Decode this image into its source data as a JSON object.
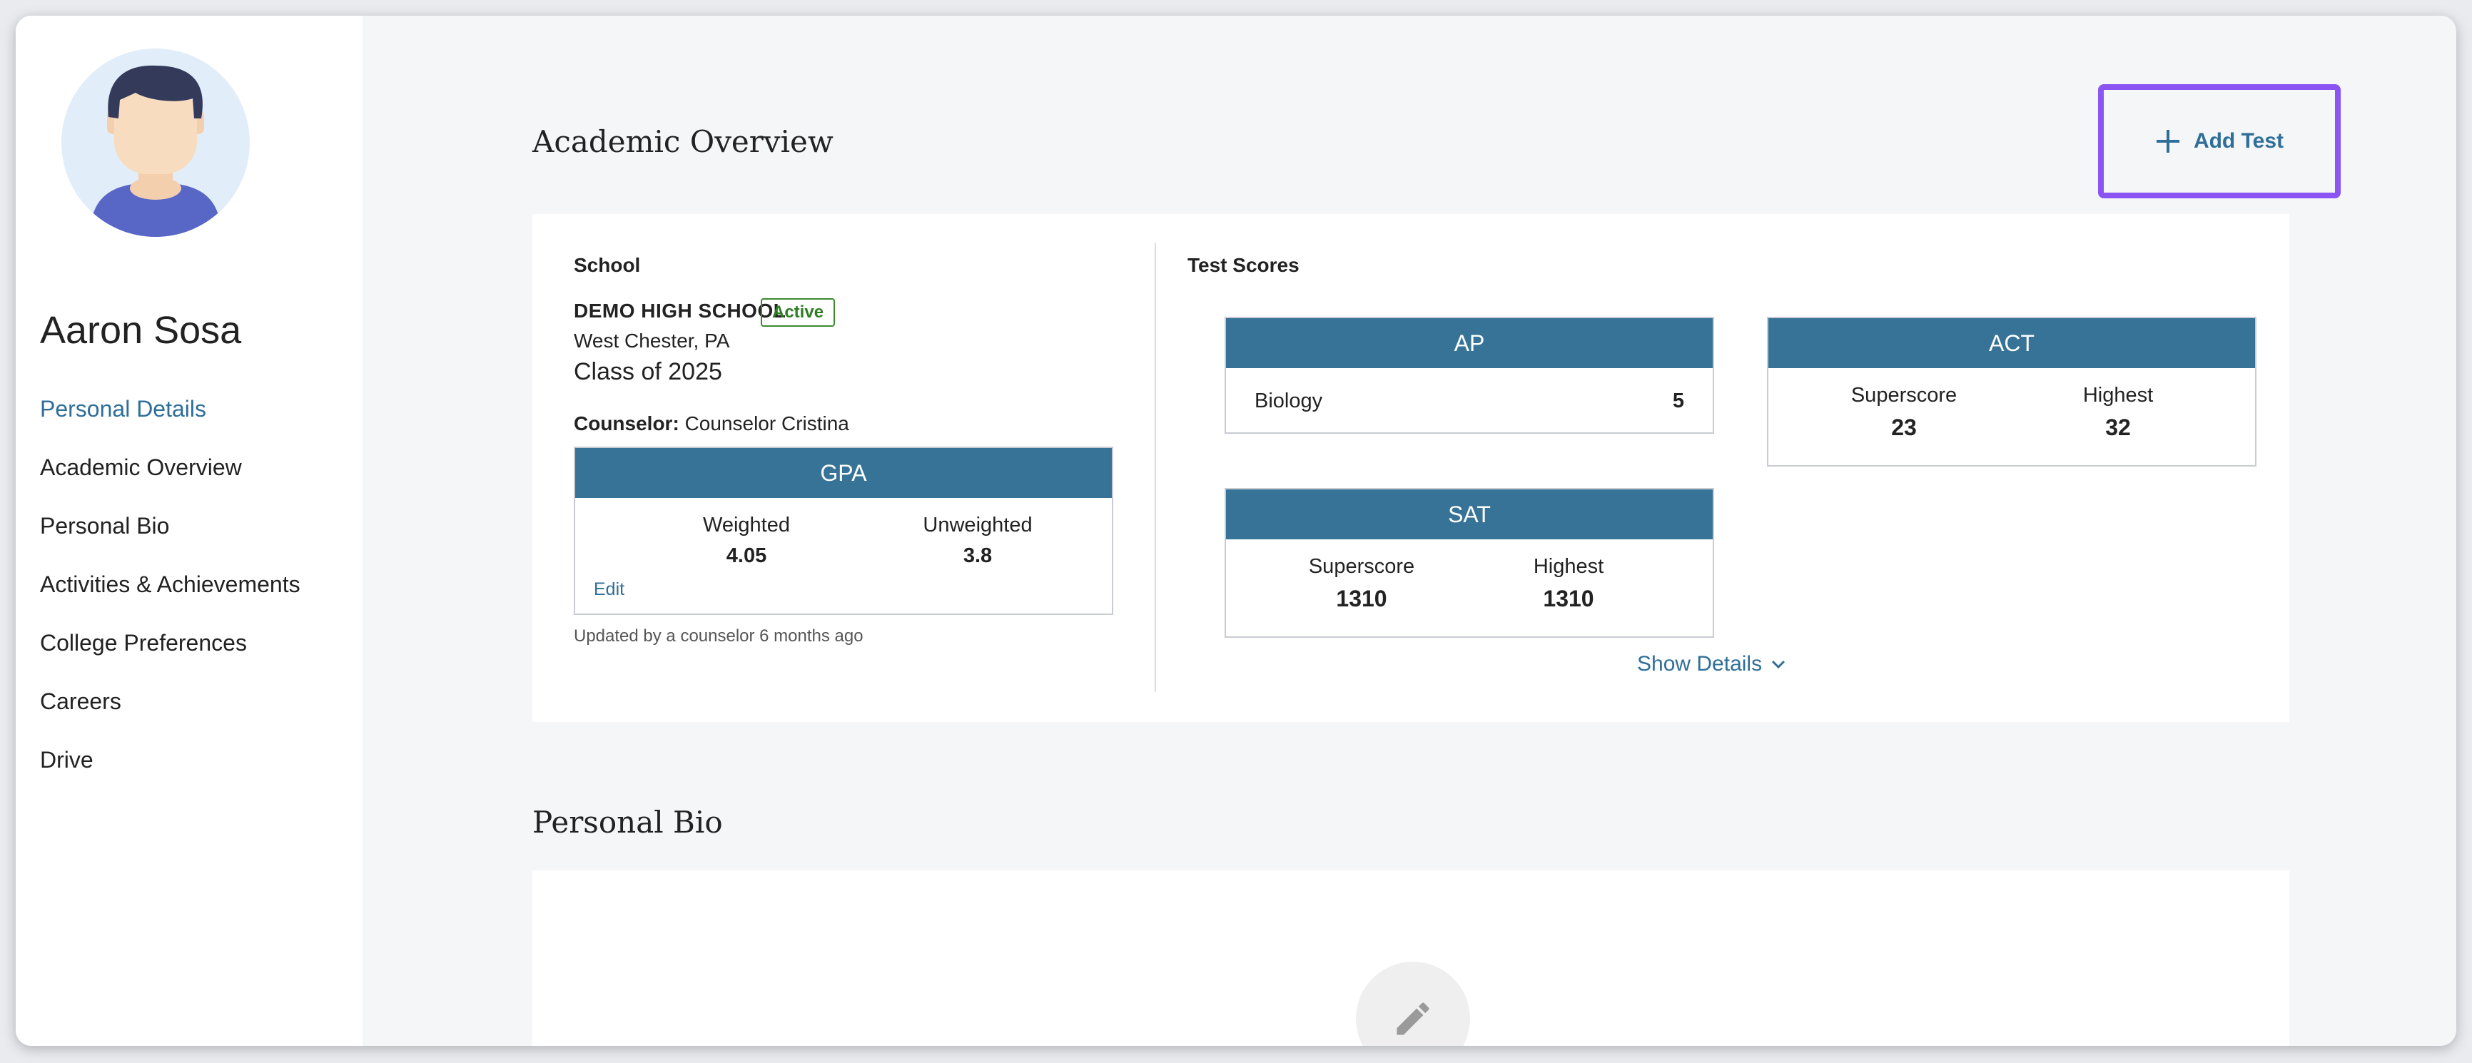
{
  "student": {
    "name": "Aaron Sosa"
  },
  "nav": {
    "items": [
      {
        "label": "Personal Details",
        "active": true
      },
      {
        "label": "Academic Overview"
      },
      {
        "label": "Personal Bio"
      },
      {
        "label": "Activities & Achievements"
      },
      {
        "label": "College Preferences"
      },
      {
        "label": "Careers"
      },
      {
        "label": "Drive"
      }
    ]
  },
  "academic": {
    "title": "Academic Overview",
    "add_test_label": "Add Test",
    "school": {
      "heading": "School",
      "name": "DEMO HIGH SCHOOL",
      "status": "Active",
      "location": "West Chester, PA",
      "class_of": "Class of 2025",
      "counselor_label": "Counselor:",
      "counselor_name": "Counselor Cristina"
    },
    "gpa": {
      "title": "GPA",
      "weighted_label": "Weighted",
      "weighted": "4.05",
      "unweighted_label": "Unweighted",
      "unweighted": "3.8",
      "edit_label": "Edit",
      "updated": "Updated by a counselor 6 months ago"
    },
    "test_scores": {
      "heading": "Test Scores",
      "ap": {
        "title": "AP",
        "subject": "Biology",
        "score": "5"
      },
      "act": {
        "title": "ACT",
        "superscore_label": "Superscore",
        "superscore": "23",
        "highest_label": "Highest",
        "highest": "32"
      },
      "sat": {
        "title": "SAT",
        "superscore_label": "Superscore",
        "superscore": "1310",
        "highest_label": "Highest",
        "highest": "1310"
      },
      "show_details_label": "Show Details"
    }
  },
  "bio": {
    "title": "Personal Bio"
  },
  "colors": {
    "accent": "#2e6e98",
    "header": "#367396",
    "highlight": "#8a55f2",
    "active_badge": "#2f7d23"
  }
}
